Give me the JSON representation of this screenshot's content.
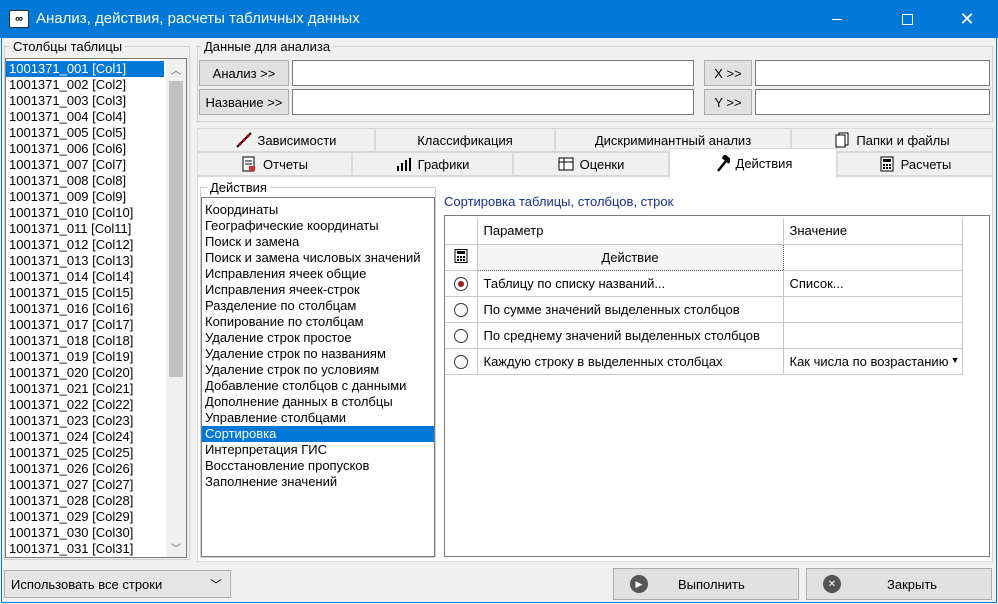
{
  "window": {
    "title": "Анализ, действия, расчеты табличных данных"
  },
  "columns_panel": {
    "label": "Столбцы таблицы",
    "items": [
      "1001371_001 [Col1]",
      "1001371_002 [Col2]",
      "1001371_003 [Col3]",
      "1001371_004 [Col4]",
      "1001371_005 [Col5]",
      "1001371_006 [Col6]",
      "1001371_007 [Col7]",
      "1001371_008 [Col8]",
      "1001371_009 [Col9]",
      "1001371_010 [Col10]",
      "1001371_011 [Col11]",
      "1001371_012 [Col12]",
      "1001371_013 [Col13]",
      "1001371_014 [Col14]",
      "1001371_015 [Col15]",
      "1001371_016 [Col16]",
      "1001371_017 [Col17]",
      "1001371_018 [Col18]",
      "1001371_019 [Col19]",
      "1001371_020 [Col20]",
      "1001371_021 [Col21]",
      "1001371_022 [Col22]",
      "1001371_023 [Col23]",
      "1001371_024 [Col24]",
      "1001371_025 [Col25]",
      "1001371_026 [Col26]",
      "1001371_027 [Col27]",
      "1001371_028 [Col28]",
      "1001371_029 [Col29]",
      "1001371_030 [Col30]",
      "1001371_031 [Col31]"
    ],
    "selected_index": 0
  },
  "analysis_data": {
    "label": "Данные для анализа",
    "analysis_button": "Анализ >>",
    "name_button": "Название >>",
    "x_button": "X >>",
    "y_button": "Y >>",
    "analysis_value": "",
    "name_value": "",
    "x_value": "",
    "y_value": ""
  },
  "tabs_row1": [
    {
      "label": "Зависимости",
      "icon": "scatter-plot-icon"
    },
    {
      "label": "Классификация",
      "icon": ""
    },
    {
      "label": "Дискриминантный анализ",
      "icon": ""
    },
    {
      "label": "Папки и файлы",
      "icon": "documents-icon"
    }
  ],
  "tabs_row2": [
    {
      "label": "Отчеты",
      "icon": "report-icon"
    },
    {
      "label": "Графики",
      "icon": "bar-chart-icon"
    },
    {
      "label": "Оценки",
      "icon": "table-icon"
    },
    {
      "label": "Действия",
      "icon": "hammer-icon",
      "active": true
    },
    {
      "label": "Расчеты",
      "icon": "calculator-icon"
    }
  ],
  "actions_panel": {
    "label": "Действия",
    "items": [
      "Координаты",
      "Географические координаты",
      "Поиск и замена",
      "Поиск и замена числовых значений",
      "Исправления ячеек общие",
      "Исправления ячеек-строк",
      "Разделение по столбцам",
      "Копирование по столбцам",
      "Удаление строк простое",
      "Удаление строк по названиям",
      "Удаление строк по условиям",
      "Добавление столбцов с данными",
      "Дополнение данных в столбцы",
      "Управление столбцами",
      "Сортировка",
      "Интерпретация ГИС",
      "Восстановление пропусков",
      "Заполнение значений"
    ],
    "selected_index": 14
  },
  "sort_panel": {
    "title": "Сортировка таблицы, столбцов, строк",
    "header_param": "Параметр",
    "header_value": "Значение",
    "action_label": "Действие",
    "rows": [
      {
        "param": "Таблицу по списку названий...",
        "value": "Список...",
        "checked": true
      },
      {
        "param": "По сумме значений выделенных столбцов",
        "value": "",
        "checked": false
      },
      {
        "param": "По среднему значений выделенных столбцов",
        "value": "",
        "checked": false
      },
      {
        "param": "Каждую строку в выделенных столбцах",
        "value": "Как числа по возрастанию",
        "checked": false
      }
    ]
  },
  "footer": {
    "rows_select": "Использовать все строки",
    "execute_button": "Выполнить",
    "close_button": "Закрыть"
  },
  "colors": {
    "accent": "#0078d7",
    "radio_dot": "#9b1c1c"
  }
}
